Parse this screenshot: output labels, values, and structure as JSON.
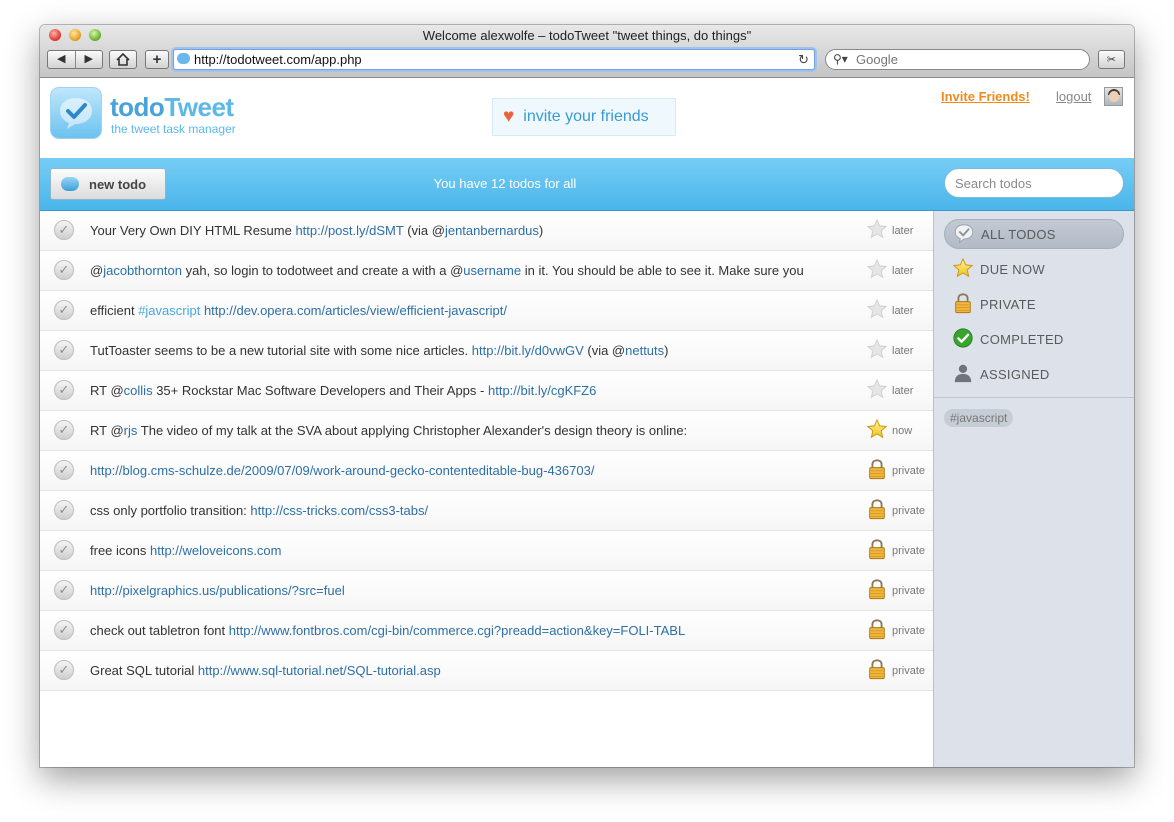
{
  "window": {
    "title": "Welcome alexwolfe – todoTweet \"tweet things, do things\"",
    "url": "http://todotweet.com/app.php",
    "search_placeholder": "Google"
  },
  "header": {
    "logo_part1": "todo",
    "logo_part2": "Tweet",
    "tagline": "the tweet task manager",
    "invite_box": "invite your friends",
    "invite_link": "Invite Friends!",
    "logout": "logout"
  },
  "toolbar": {
    "new_todo": "new todo",
    "count_text": "You have 12 todos for all",
    "search_placeholder": "Search todos"
  },
  "todos": [
    {
      "segments": [
        {
          "t": "Your Very Own DIY HTML Resume "
        },
        {
          "t": "http://post.ly/dSMT",
          "k": "link"
        },
        {
          "t": " (via @"
        },
        {
          "t": "jentanbernardus",
          "k": "link"
        },
        {
          "t": ")"
        }
      ],
      "status": "later",
      "icon": "star-empty"
    },
    {
      "segments": [
        {
          "t": "@"
        },
        {
          "t": "jacobthornton",
          "k": "link"
        },
        {
          "t": " yah, so login to todotweet and create a with a @"
        },
        {
          "t": "username",
          "k": "link"
        },
        {
          "t": " in it. You should be able to see it. Make sure you"
        }
      ],
      "status": "later",
      "icon": "star-empty"
    },
    {
      "segments": [
        {
          "t": "efficient "
        },
        {
          "t": "#javascript",
          "k": "tag"
        },
        {
          "t": " "
        },
        {
          "t": "http://dev.opera.com/articles/view/efficient-javascript/",
          "k": "link"
        }
      ],
      "status": "later",
      "icon": "star-empty"
    },
    {
      "segments": [
        {
          "t": "TutToaster seems to be a new tutorial site with some nice articles. "
        },
        {
          "t": "http://bit.ly/d0vwGV",
          "k": "link"
        },
        {
          "t": " (via @"
        },
        {
          "t": "nettuts",
          "k": "link"
        },
        {
          "t": ")"
        }
      ],
      "status": "later",
      "icon": "star-empty"
    },
    {
      "segments": [
        {
          "t": "RT @"
        },
        {
          "t": "collis",
          "k": "link"
        },
        {
          "t": " 35+ Rockstar Mac Software Developers and Their Apps - "
        },
        {
          "t": "http://bit.ly/cgKFZ6",
          "k": "link"
        }
      ],
      "status": "later",
      "icon": "star-empty"
    },
    {
      "segments": [
        {
          "t": "RT @"
        },
        {
          "t": "rjs",
          "k": "link"
        },
        {
          "t": " The video of my talk at the SVA about applying Christopher Alexander's design theory is online:"
        }
      ],
      "status": "now",
      "icon": "star-gold"
    },
    {
      "segments": [
        {
          "t": "http://blog.cms-schulze.de/2009/07/09/work-around-gecko-contenteditable-bug-436703/",
          "k": "link"
        }
      ],
      "status": "private",
      "icon": "lock"
    },
    {
      "segments": [
        {
          "t": "css only portfolio transition: "
        },
        {
          "t": "http://css-tricks.com/css3-tabs/",
          "k": "link"
        }
      ],
      "status": "private",
      "icon": "lock"
    },
    {
      "segments": [
        {
          "t": "free icons "
        },
        {
          "t": "http://weloveicons.com",
          "k": "link"
        }
      ],
      "status": "private",
      "icon": "lock"
    },
    {
      "segments": [
        {
          "t": "http://pixelgraphics.us/publications/?src=fuel",
          "k": "link"
        }
      ],
      "status": "private",
      "icon": "lock"
    },
    {
      "segments": [
        {
          "t": "check out tabletron font "
        },
        {
          "t": "http://www.fontbros.com/cgi-bin/commerce.cgi?preadd=action&key=FOLI-TABL",
          "k": "link"
        }
      ],
      "status": "private",
      "icon": "lock"
    },
    {
      "segments": [
        {
          "t": "Great SQL tutorial "
        },
        {
          "t": "http://www.sql-tutorial.net/SQL-tutorial.asp",
          "k": "link"
        }
      ],
      "status": "private",
      "icon": "lock"
    }
  ],
  "sidebar": {
    "items": [
      {
        "label": "ALL TODOS",
        "icon": "check-bubble-icon",
        "active": true
      },
      {
        "label": "DUE NOW",
        "icon": "star-icon",
        "active": false
      },
      {
        "label": "PRIVATE",
        "icon": "lock-icon",
        "active": false
      },
      {
        "label": "COMPLETED",
        "icon": "green-check-icon",
        "active": false
      },
      {
        "label": "ASSIGNED",
        "icon": "person-icon",
        "active": false
      }
    ],
    "tag": "#javascript"
  },
  "colors": {
    "accent_blue": "#4ab5ea",
    "link": "#2d6fa6",
    "invite_orange": "#f08a1e"
  }
}
